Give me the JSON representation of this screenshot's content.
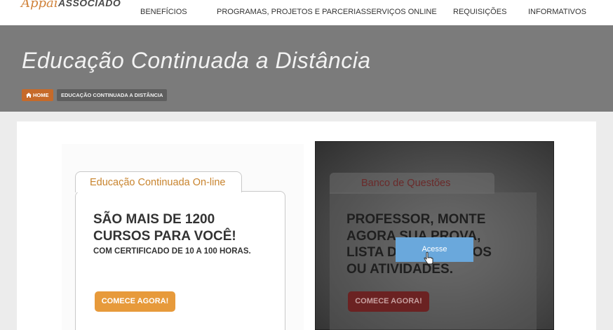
{
  "header": {
    "logo_script": "Appai",
    "logo_word": "ASSOCIADO",
    "nav": [
      {
        "label": "BENEFÍCIOS"
      },
      {
        "label": "PROGRAMAS, PROJETOS E PARCERIAS"
      },
      {
        "label": "SERVIÇOS ONLINE"
      },
      {
        "label": "REQUISIÇÕES"
      },
      {
        "label": "INFORMATIVOS"
      }
    ]
  },
  "hero": {
    "title": "Educação Continuada a Distância",
    "breadcrumb": {
      "home": "HOME",
      "current": "EDUCAÇÃO CONTINUADA A DISTÂNCIA"
    }
  },
  "cards": {
    "left": {
      "tab": "Educação Continuada On-line",
      "heading_1": "SÃO MAIS DE 1200",
      "heading_2": "CURSOS PARA VOCÊ!",
      "subheading": "COM CERTIFICADO DE 10 A 100 HORAS.",
      "button": "COMECE AGORA!"
    },
    "right": {
      "tab": "Banco de Questões",
      "heading_1": "PROFESSOR, MONTE",
      "heading_2": "AGORA SUA PROVA,",
      "heading_3": "LISTA DE EXERCÍCIOS",
      "heading_4": "OU ATIVIDADES.",
      "button": "COMECE AGORA!",
      "overlay_button": "Acesse"
    }
  },
  "colors": {
    "accent_orange": "#e79a3b",
    "breadcrumb_home": "#c66a2a",
    "hero_band": "#7b7b7b",
    "overlay_blue": "#6aa8dc"
  }
}
